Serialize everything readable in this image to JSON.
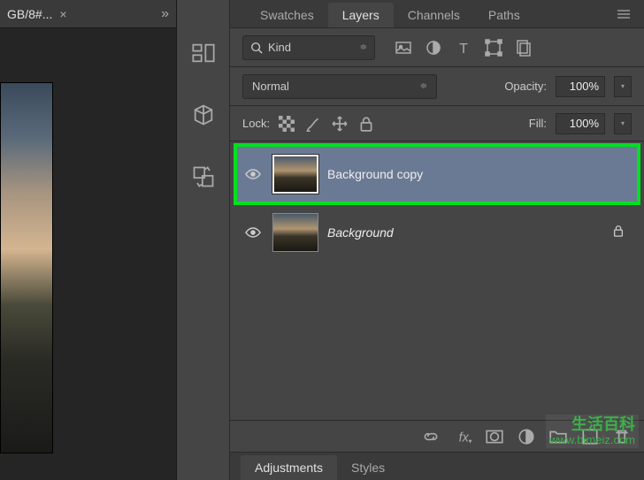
{
  "document": {
    "tab_label": "GB/8#...",
    "close_glyph": "×",
    "expand_glyph": "»"
  },
  "panel_tabs": {
    "swatches": "Swatches",
    "layers": "Layers",
    "channels": "Channels",
    "paths": "Paths"
  },
  "filter": {
    "kind_label": "Kind",
    "kind_chevron": "≑"
  },
  "blend": {
    "mode": "Normal",
    "mode_chevron": "≑",
    "opacity_label": "Opacity:",
    "opacity_value": "100%",
    "dropdown_glyph": "▾"
  },
  "lock": {
    "label": "Lock:",
    "fill_label": "Fill:",
    "fill_value": "100%",
    "dropdown_glyph": "▾"
  },
  "layers": [
    {
      "name": "Background copy",
      "selected": true,
      "locked": false,
      "italic": false
    },
    {
      "name": "Background",
      "selected": false,
      "locked": true,
      "italic": true
    }
  ],
  "sub_tabs": {
    "adjustments": "Adjustments",
    "styles": "Styles"
  },
  "watermark": {
    "brand": "生活百科",
    "url": "www.bimeiz.com"
  }
}
